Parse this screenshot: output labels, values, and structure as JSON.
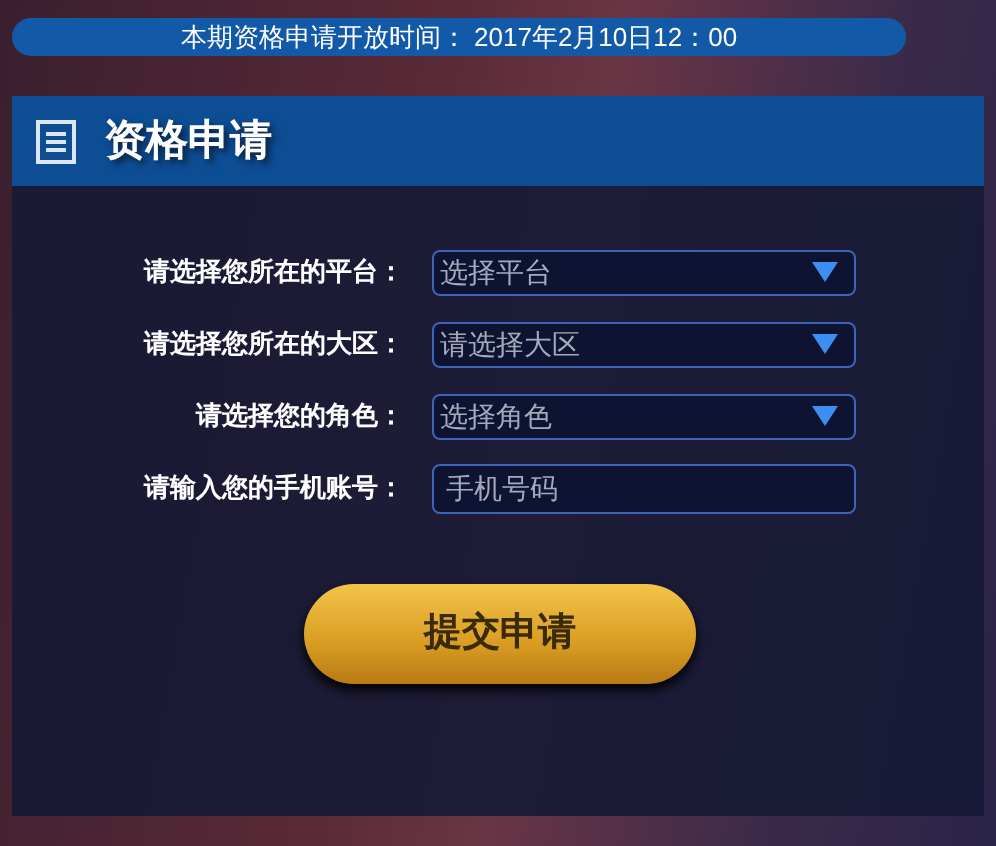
{
  "notice": "本期资格申请开放时间： 2017年2月10日12：00",
  "panel": {
    "title": "资格申请",
    "fields": [
      {
        "kind": "select",
        "label": "请选择您所在的平台：",
        "placeholder": "选择平台"
      },
      {
        "kind": "select",
        "label": "请选择您所在的大区：",
        "placeholder": "请选择大区"
      },
      {
        "kind": "select",
        "label": "请选择您的角色：",
        "placeholder": "选择角色"
      },
      {
        "kind": "input",
        "label": "请输入您的手机账号：",
        "placeholder": "手机号码"
      }
    ],
    "submit": "提交申请"
  }
}
